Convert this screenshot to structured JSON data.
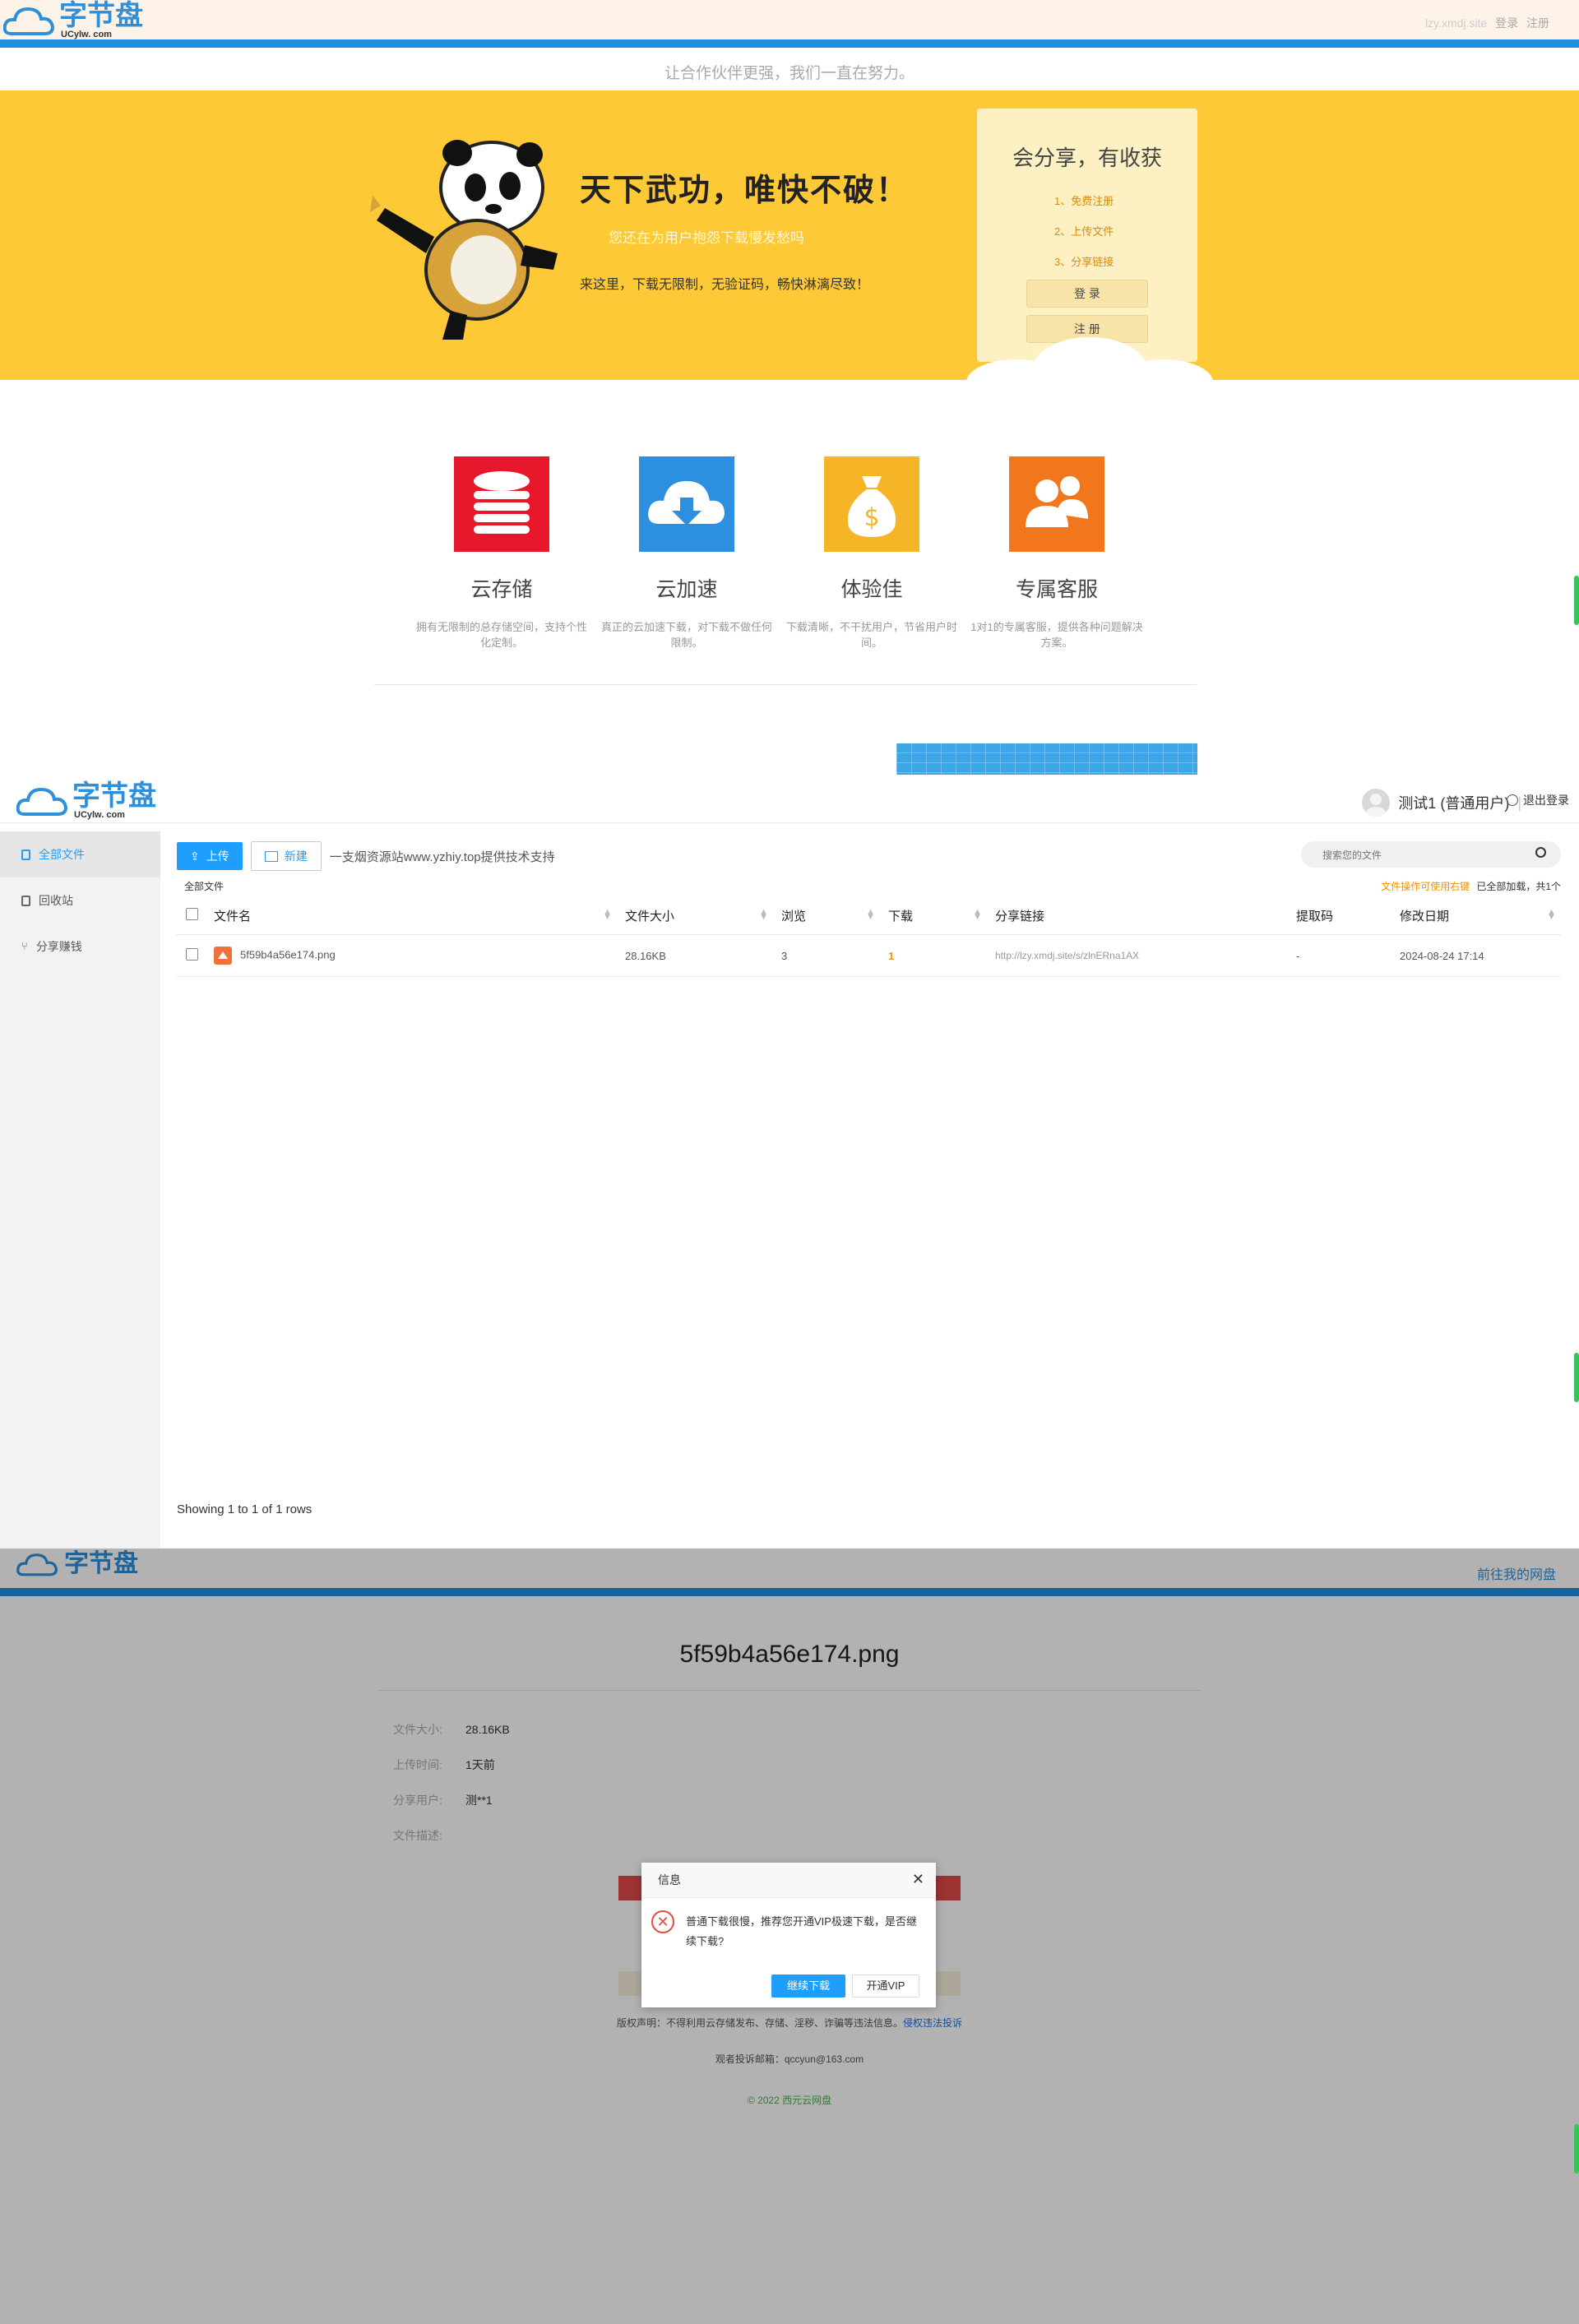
{
  "landing": {
    "brand_text": "字节盘",
    "brand_sub": "UCylw. com",
    "topbar_domain": "lzy.xmdj.site",
    "topbar_login": "登录",
    "topbar_register": "注册",
    "slogan": "让合作伙伴更强，我们一直在努力。",
    "hero_title": "天下武功，唯快不破！",
    "hero_subtitle": "您还在为用户抱怨下载慢发愁吗",
    "hero_desc": "来这里，下载无限制，无验证码，畅快淋漓尽致！",
    "card_title": "会分享，有收获",
    "card_steps": [
      "1、免费注册",
      "2、上传文件",
      "3、分享链接"
    ],
    "login_button": "登 录",
    "register_button": "注 册",
    "features": [
      {
        "name": "云存储",
        "desc": "拥有无限制的总存储空间，支持个性化定制。",
        "icon": "database-icon",
        "color": "#e8182c"
      },
      {
        "name": "云加速",
        "desc": "真正的云加速下载，对下载不做任何限制。",
        "icon": "cloud-download-icon",
        "color": "#2d8fe0"
      },
      {
        "name": "体验佳",
        "desc": "下载清晰，不干扰用户，节省用户时间。",
        "icon": "money-bag-icon",
        "color": "#f6b427"
      },
      {
        "name": "专属客服",
        "desc": "1对1的专属客服，提供各种问题解决方案。",
        "icon": "customer-service-icon",
        "color": "#f2761b"
      }
    ]
  },
  "file_manager": {
    "brand_text": "字节盘",
    "brand_sub": "UCylw. com",
    "user_name": "测试1 (普通用户)",
    "logout_label": "退出登录",
    "sidebar": [
      {
        "label": "全部文件",
        "icon": "file-icon",
        "active": true
      },
      {
        "label": "回收站",
        "icon": "trash-icon",
        "active": false
      },
      {
        "label": "分享赚钱",
        "icon": "share-icon",
        "active": false
      }
    ],
    "upload_label": "上传",
    "new_label": "新建",
    "toolbar_note": "一支烟资源站www.yzhiy.top提供技术支持",
    "search_placeholder": "搜索您的文件",
    "breadcrumb": "全部文件",
    "right_hint": "文件操作可使用右键",
    "load_status": "已全部加载，共1个",
    "columns": [
      "文件名",
      "文件大小",
      "浏览",
      "下载",
      "分享链接",
      "提取码",
      "修改日期"
    ],
    "rows": [
      {
        "name": "5f59b4a56e174.png",
        "size": "28.16KB",
        "views": "3",
        "downloads": "1",
        "link": "http://lzy.xmdj.site/s/zlnERna1AX",
        "code": "-",
        "modified": "2024-08-24 17:14"
      }
    ],
    "pagination": "Showing 1 to 1 of 1 rows"
  },
  "share_page": {
    "brand_text": "字节盘",
    "goto_label": "前往我的网盘",
    "file_title": "5f59b4a56e174.png",
    "meta": [
      {
        "label": "文件大小:",
        "value": "28.16KB"
      },
      {
        "label": "上传时间:",
        "value": "1天前"
      },
      {
        "label": "分享用户:",
        "value": "测**1"
      },
      {
        "label": "文件描述:",
        "value": ""
      }
    ],
    "copyright_text": "版权声明：不得利用云存储发布、存储、淫秽、诈骗等违法信息。",
    "report_link": "侵权违法投诉",
    "contact": "观者投诉邮箱：qccyun@163.com",
    "footer": "© 2022 西元云网盘",
    "modal": {
      "title": "信息",
      "message": "普通下载很慢，推荐您开通VIP极速下载，是否继续下载?",
      "continue_label": "继续下载",
      "vip_label": "开通VIP"
    }
  }
}
